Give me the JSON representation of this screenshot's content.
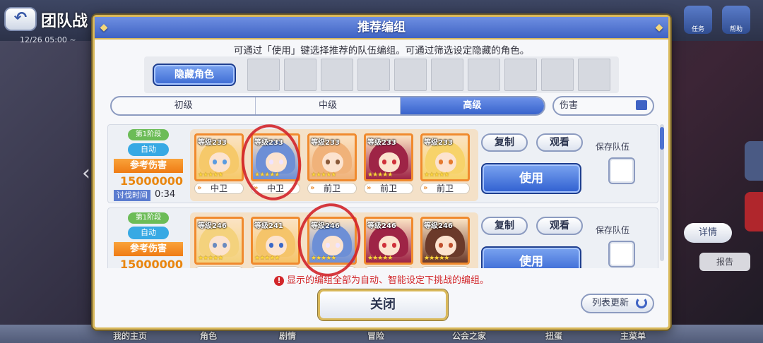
{
  "background": {
    "back_symbol": "↶",
    "title": "团队战",
    "date_text": "12/26 05:00 ~",
    "right_top_icons": [
      "任务",
      "帮助"
    ],
    "detail_button": "详情",
    "report_button": "报告",
    "bottom_nav": [
      "我的主页",
      "角色",
      "剧情",
      "冒险",
      "公会之家",
      "扭蛋",
      "主菜单"
    ]
  },
  "modal": {
    "title": "推荐编组",
    "instruction": "可通过「使用」键选择推荐的队伍编组。可通过筛选设定隐藏的角色。",
    "hide_button": "隐藏角色",
    "hide_slot_count": 10,
    "tabs": [
      {
        "label": "初级",
        "active": false
      },
      {
        "label": "中级",
        "active": false
      },
      {
        "label": "高级",
        "active": true
      }
    ],
    "filter_label": "伤害",
    "teams": [
      {
        "stage": "第1阶段",
        "mode": "自动",
        "damage_label": "参考伤害",
        "damage_value": "15000000",
        "time_label": "讨伐时间",
        "time_value": "0:34",
        "units": [
          {
            "level": "等级233",
            "stars": "★★★★★",
            "position": "中卫",
            "hair": "#f6c96a",
            "eyes": "#5a9be0"
          },
          {
            "level": "等级233",
            "stars": "★★★★★",
            "position": "中卫",
            "hair": "#6d8fd6",
            "eyes": "#f0e4ff"
          },
          {
            "level": "等级233",
            "stars": "★★★★★",
            "position": "前卫",
            "hair": "#f0b27a",
            "eyes": "#8a5a3a"
          },
          {
            "level": "等级233",
            "stars": "★★★★★",
            "position": "前卫",
            "hair": "#9e2446",
            "eyes": "#d0303a"
          },
          {
            "level": "等级233",
            "stars": "★★★★★",
            "position": "前卫",
            "hair": "#f7d36a",
            "eyes": "#e67a2e"
          }
        ],
        "copy_button": "复制",
        "watch_button": "观看",
        "use_button": "使用",
        "save_label": "保存队伍"
      },
      {
        "stage": "第1阶段",
        "mode": "自动",
        "damage_label": "参考伤害",
        "damage_value": "15000000",
        "time_label": "",
        "time_value": "",
        "units": [
          {
            "level": "等级246",
            "stars": "★★★★★",
            "position": "",
            "hair": "#f4d27d",
            "eyes": "#6a8ac0"
          },
          {
            "level": "等级241",
            "stars": "★★★★★",
            "position": "",
            "hair": "#f5c46a",
            "eyes": "#3a68c8"
          },
          {
            "level": "等级246",
            "stars": "★★★★★",
            "position": "",
            "hair": "#6d8fd6",
            "eyes": "#f0e4ff"
          },
          {
            "level": "等级246",
            "stars": "★★★★★",
            "position": "",
            "hair": "#9e2446",
            "eyes": "#d0303a"
          },
          {
            "level": "等级246",
            "stars": "★★★★★",
            "position": "",
            "hair": "#6b3a2a",
            "eyes": "#c0502e"
          }
        ],
        "copy_button": "复制",
        "watch_button": "观看",
        "use_button": "使用",
        "save_label": "保存队伍"
      }
    ],
    "warning": "显示的编组全部为自动、智能设定下挑战的编组。",
    "warning_icon": "!",
    "close_button": "关闭",
    "refresh_button": "列表更新"
  },
  "colors": {
    "accent_blue": "#3f63c4",
    "gold_border": "#d9b85a",
    "damage_orange": "#ef7b14",
    "warning_red": "#d2272b",
    "annotation_red": "#d2232a"
  }
}
